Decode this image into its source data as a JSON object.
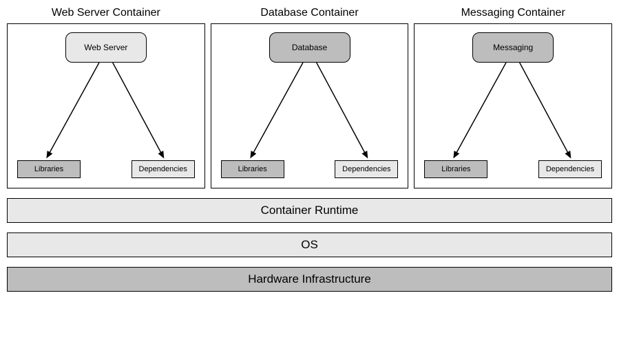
{
  "containers": [
    {
      "title": "Web Server Container",
      "service": "Web Server",
      "serviceClass": "service-light",
      "libraries": "Libraries",
      "dependencies": "Dependencies"
    },
    {
      "title": "Database Container",
      "service": "Database",
      "serviceClass": "service-dark",
      "libraries": "Libraries",
      "dependencies": "Dependencies"
    },
    {
      "title": "Messaging Container",
      "service": "Messaging",
      "serviceClass": "service-dark",
      "libraries": "Libraries",
      "dependencies": "Dependencies"
    }
  ],
  "layers": {
    "runtime": "Container Runtime",
    "os": "OS",
    "hardware": "Hardware Infrastructure"
  }
}
